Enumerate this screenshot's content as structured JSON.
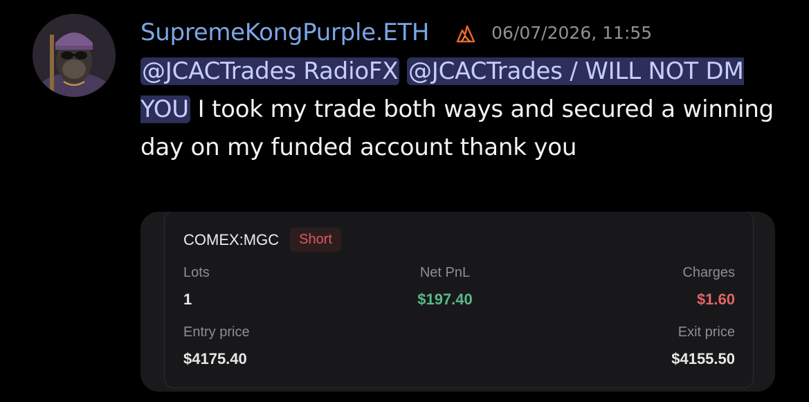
{
  "message": {
    "author": "SupremeKongPurple.ETH",
    "role_icon": "flame-icon",
    "timestamp": "06/07/2026, 11:55",
    "mentions": [
      "@JCACTrades RadioFX",
      "@JCACTrades / WILL NOT DM YOU"
    ],
    "text": " I took my trade both ways and secured a winning day on my funded account thank you"
  },
  "trade_card": {
    "symbol": "COMEX:MGC",
    "side": "Short",
    "lots_label": "Lots",
    "lots_value": "1",
    "pnl_label": "Net PnL",
    "pnl_value": "$197.40",
    "charges_label": "Charges",
    "charges_value": "$1.60",
    "entry_label": "Entry price",
    "entry_value": "$4175.40",
    "exit_label": "Exit price",
    "exit_value": "$4155.50"
  },
  "colors": {
    "username": "#7ba6e6",
    "mention_bg": "#2c2f5a",
    "mention_text": "#c9cdfb",
    "profit": "#57b88a",
    "loss": "#e06666"
  }
}
